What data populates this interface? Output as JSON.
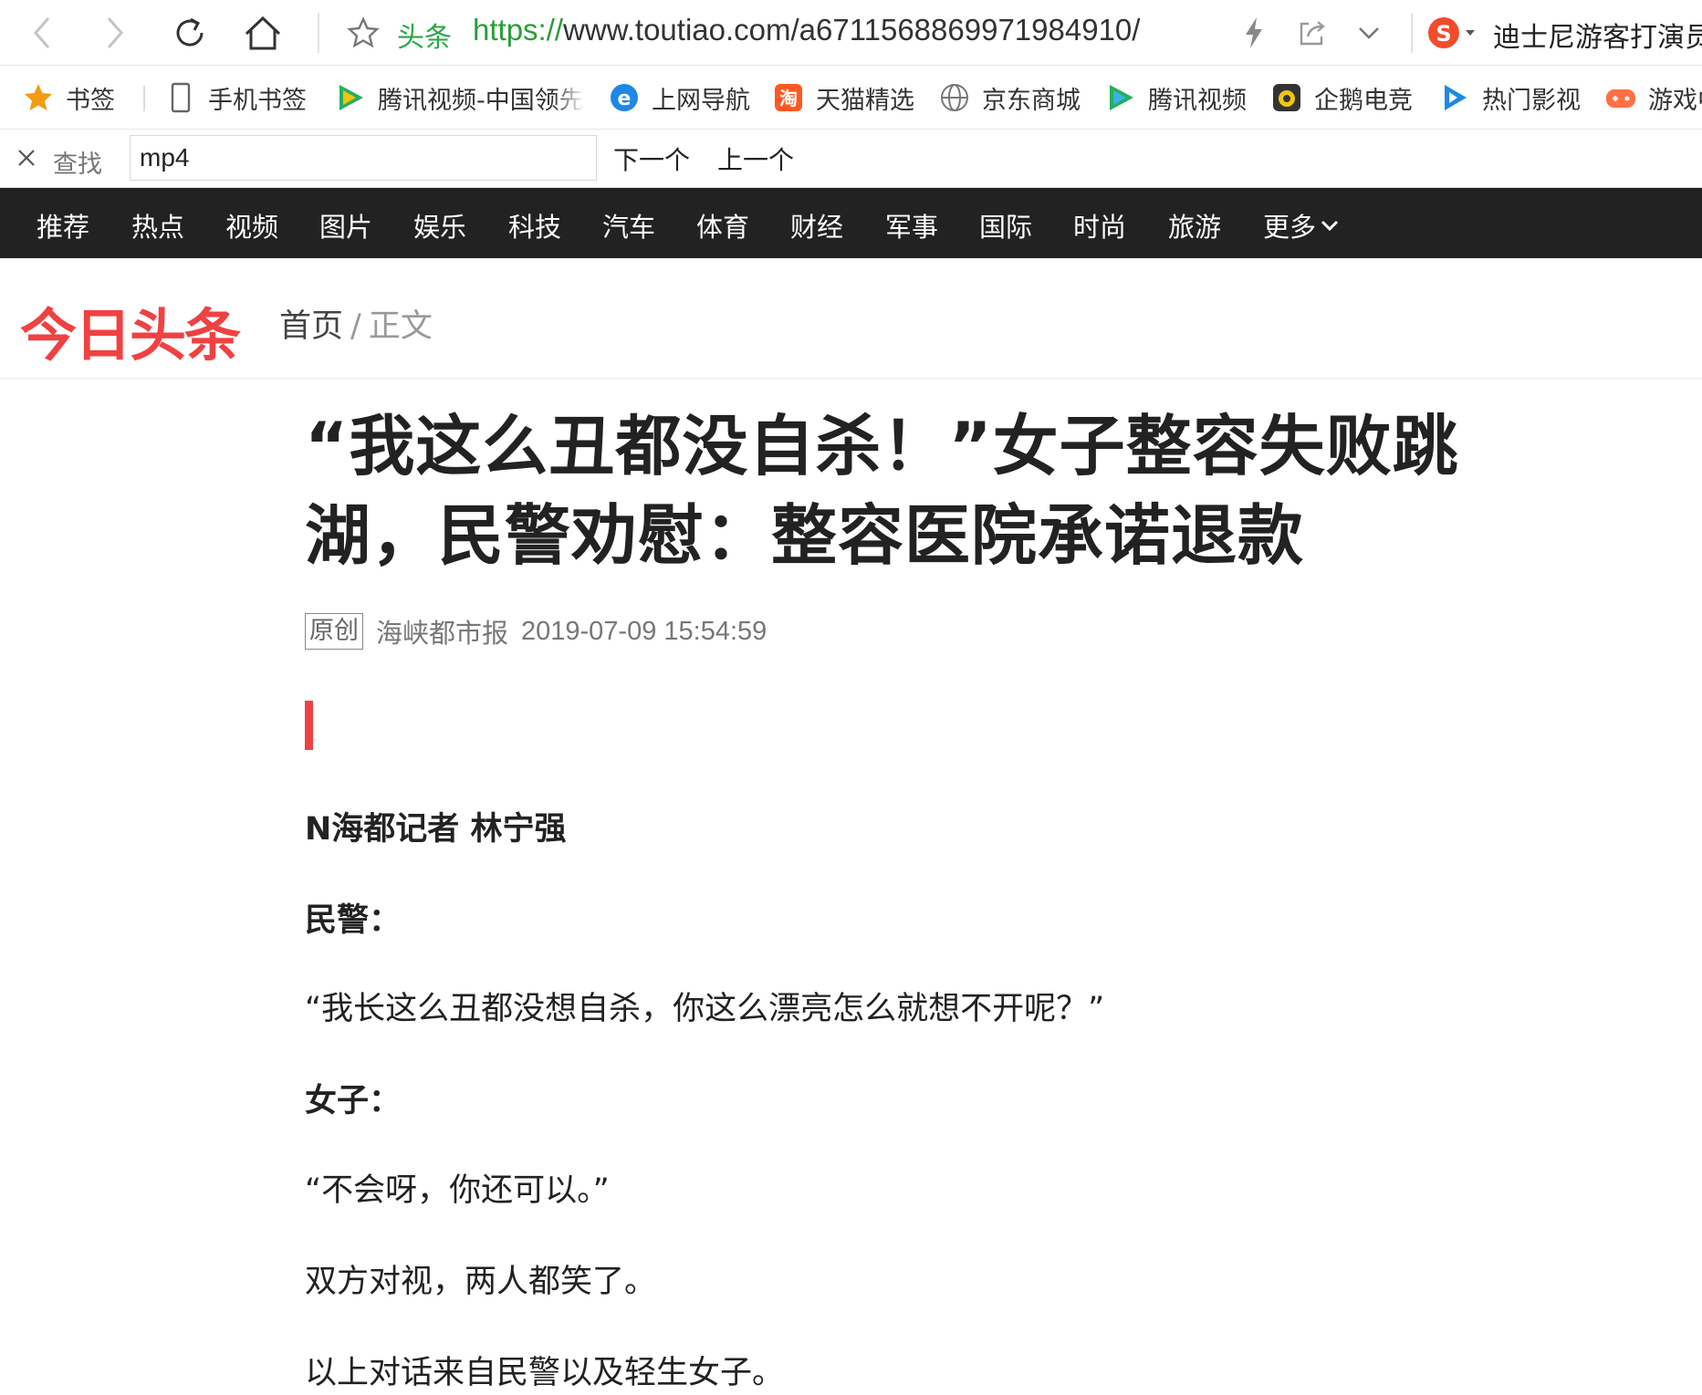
{
  "browser": {
    "site_name": "头条",
    "url_scheme": "https://",
    "url_rest": "www.toutiao.com/a6711568869971984910/",
    "search_suggestion": "迪士尼游客打演员"
  },
  "bookmarks": [
    {
      "label": "书签",
      "icon": "star-icon",
      "color": "#f39c12"
    },
    {
      "label": "手机书签",
      "icon": "phone-icon",
      "color": "#666666"
    },
    {
      "label": "腾讯视频-中国领先",
      "icon": "tencent-video-icon",
      "color": "#27ae60"
    },
    {
      "label": "上网导航",
      "icon": "ie-icon",
      "color": "#1e88e5"
    },
    {
      "label": "天猫精选",
      "icon": "tmall-icon",
      "color": "#ff5722"
    },
    {
      "label": "京东商城",
      "icon": "globe-icon",
      "color": "#666666"
    },
    {
      "label": "腾讯视频",
      "icon": "tencent-video-icon",
      "color": "#27ae60"
    },
    {
      "label": "企鹅电竞",
      "icon": "penguin-esports-icon",
      "color": "#333333"
    },
    {
      "label": "热门影视",
      "icon": "play-icon",
      "color": "#1e88e5"
    },
    {
      "label": "游戏中",
      "icon": "gamepad-icon",
      "color": "#ff7043"
    }
  ],
  "find": {
    "label": "查找",
    "query": "mp4",
    "next": "下一个",
    "prev": "上一个"
  },
  "site_nav": [
    "推荐",
    "热点",
    "视频",
    "图片",
    "娱乐",
    "科技",
    "汽车",
    "体育",
    "财经",
    "军事",
    "国际",
    "时尚",
    "旅游"
  ],
  "site_nav_more": "更多",
  "header": {
    "logo": "今日头条",
    "crumb_home": "首页",
    "crumb_sep": "/",
    "crumb_current": "正文"
  },
  "article": {
    "title": "“我这么丑都没自杀！”女子整容失败跳湖，民警劝慰：整容医院承诺退款",
    "tag": "原创",
    "source": "海峡都市报",
    "time": "2019-07-09 15:54:59",
    "paragraphs": [
      {
        "text": "N海都记者 林宁强",
        "bold": true
      },
      {
        "text": "民警：",
        "bold": true
      },
      {
        "text": "“我长这么丑都没想自杀，你这么漂亮怎么就想不开呢？”",
        "bold": false
      },
      {
        "text": "女子：",
        "bold": true
      },
      {
        "text": "“不会呀，你还可以。”",
        "bold": false
      },
      {
        "text": "双方对视，两人都笑了。",
        "bold": false
      },
      {
        "text": "以上对话来自民警以及轻生女子。",
        "bold": false
      }
    ]
  },
  "colors": {
    "brand_red": "#f04142",
    "nav_bg": "#222222",
    "url_green": "#2a9d38"
  }
}
